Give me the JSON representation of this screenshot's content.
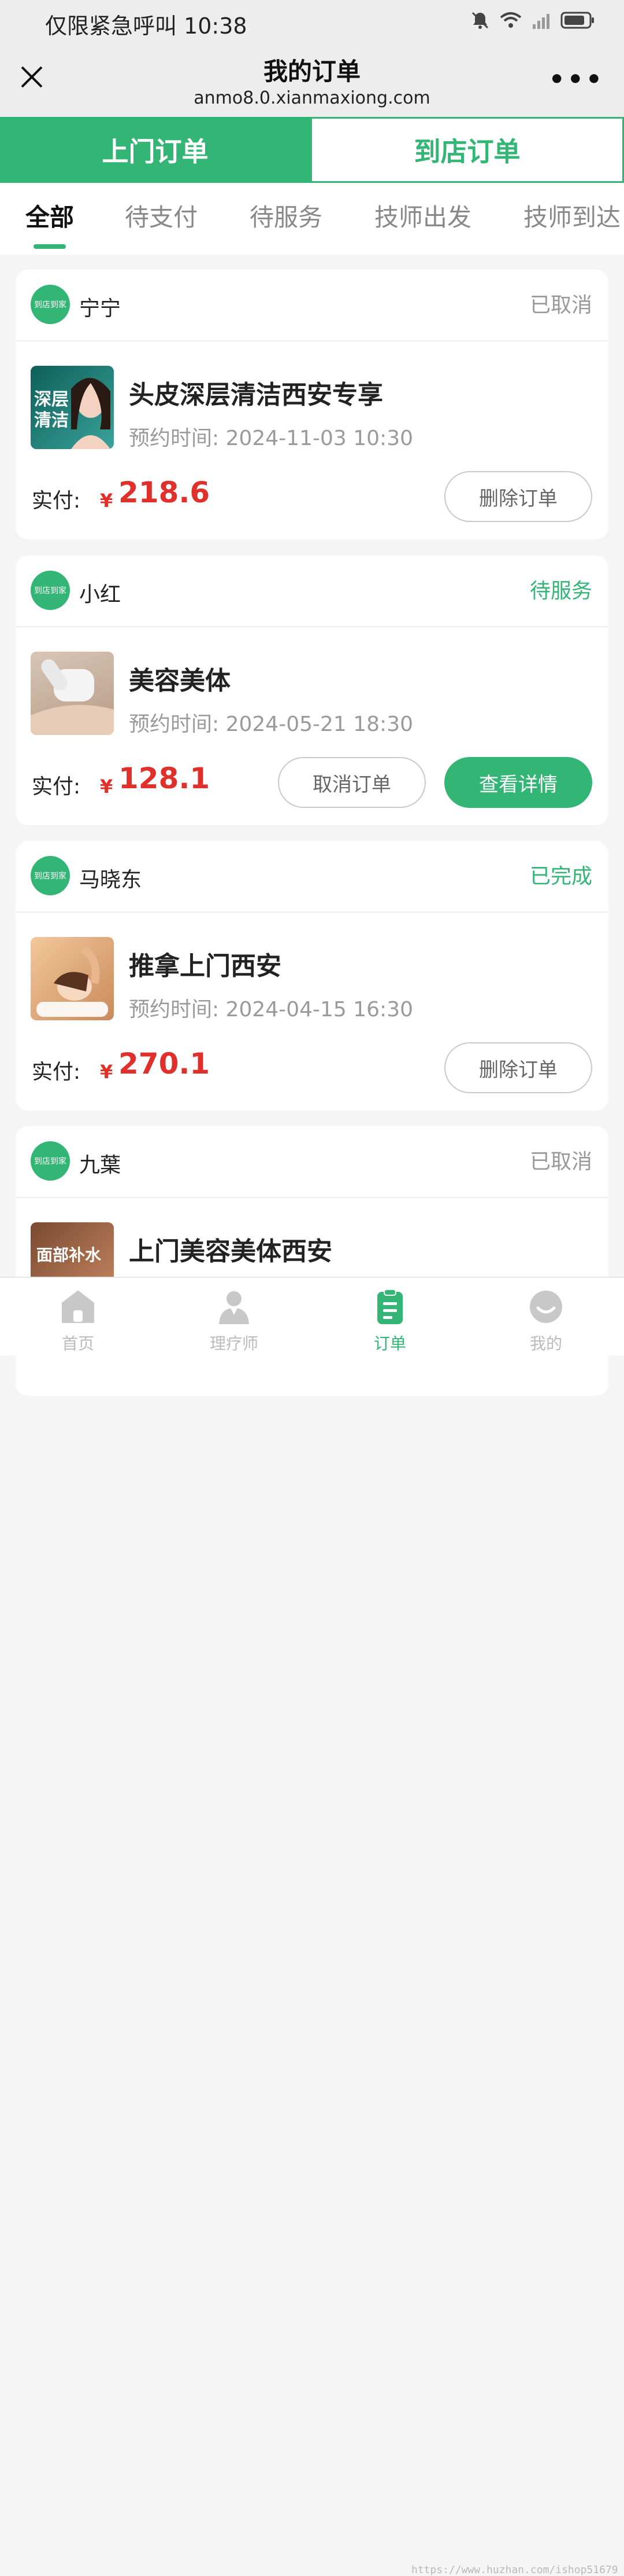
{
  "status_bar": {
    "text": "仅限紧急呼叫 10:38"
  },
  "nav": {
    "title": "我的订单",
    "url": "anmo8.0.xianmaxiong.com"
  },
  "segment": {
    "active_label": "上门订单",
    "inactive_label": "到店订单"
  },
  "tabs": [
    "全部",
    "待支付",
    "待服务",
    "技师出发",
    "技师到达"
  ],
  "labels": {
    "paid": "实付:",
    "currency": "¥",
    "time_prefix": "预约时间:"
  },
  "shop_logo_text": "到店到家",
  "orders": [
    {
      "shop": "宁宁",
      "status": "已取消",
      "status_color": "#999999",
      "product": "头皮深层清洁西安专享",
      "time": "2024-11-03 10:30",
      "amount": "218.6",
      "buttons": [
        "删除订单"
      ],
      "thumb_text": "深层\n清洁"
    },
    {
      "shop": "小红",
      "status": "待服务",
      "status_color": "#32b575",
      "product": "美容美体",
      "time": "2024-05-21 18:30",
      "amount": "128.1",
      "buttons": [
        "取消订单",
        "查看详情"
      ]
    },
    {
      "shop": "马晓东",
      "status": "已完成",
      "status_color": "#32b575",
      "product": "推拿上门西安",
      "time": "2024-04-15 16:30",
      "amount": "270.1",
      "buttons": [
        "删除订单"
      ]
    },
    {
      "shop": "九葉",
      "status": "已取消",
      "status_color": "#999999",
      "product": "上门美容美体西安",
      "thumb_text": "面部补水"
    }
  ],
  "tabbar": [
    "首页",
    "理疗师",
    "订单",
    "我的"
  ],
  "watermark": "https://www.huzhan.com/ishop51679",
  "colors": {
    "accent": "#32b575",
    "price": "#e0302b"
  }
}
